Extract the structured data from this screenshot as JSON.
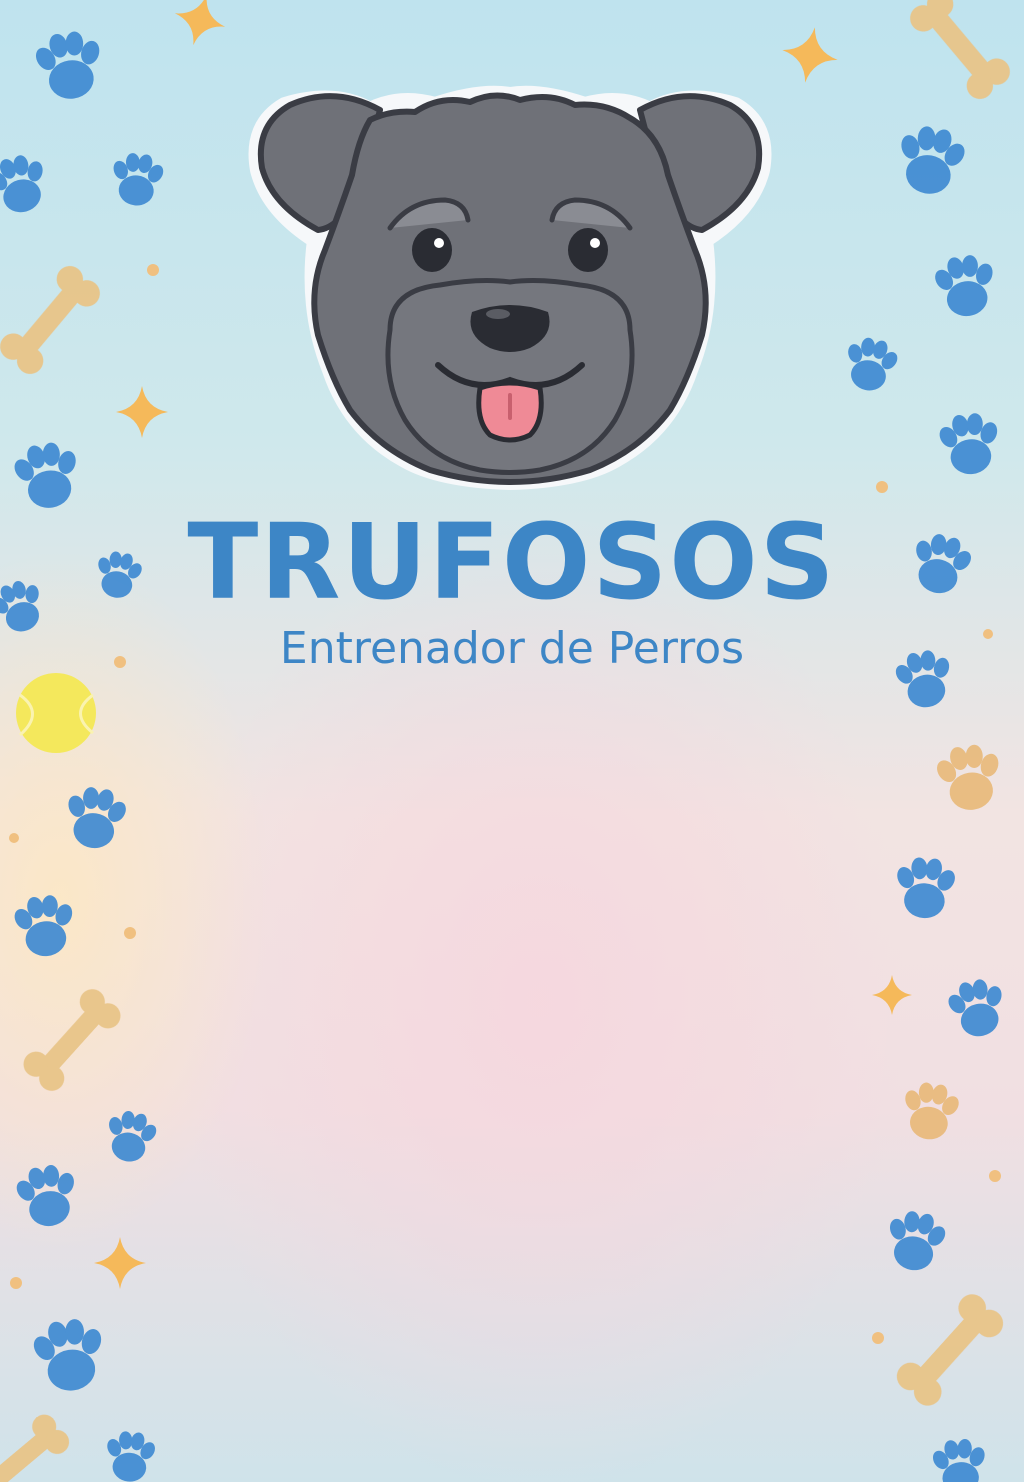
{
  "brand": {
    "name": "TRUFOSOS",
    "tagline": "Entrenador de Perros"
  },
  "colors": {
    "brand_blue": "#3d86c6",
    "paw_blue": "#3f8ad2",
    "bone_tan": "#e8c488",
    "sparkle_orange": "#f5b95a",
    "dog_gray": "#6f7178",
    "tongue_pink": "#ef8a96",
    "ball_yellow": "#f4e85c"
  },
  "icons": [
    "dog-face-logo",
    "paw-print-icon",
    "dog-bone-icon",
    "sparkle-icon",
    "tennis-ball-icon"
  ]
}
